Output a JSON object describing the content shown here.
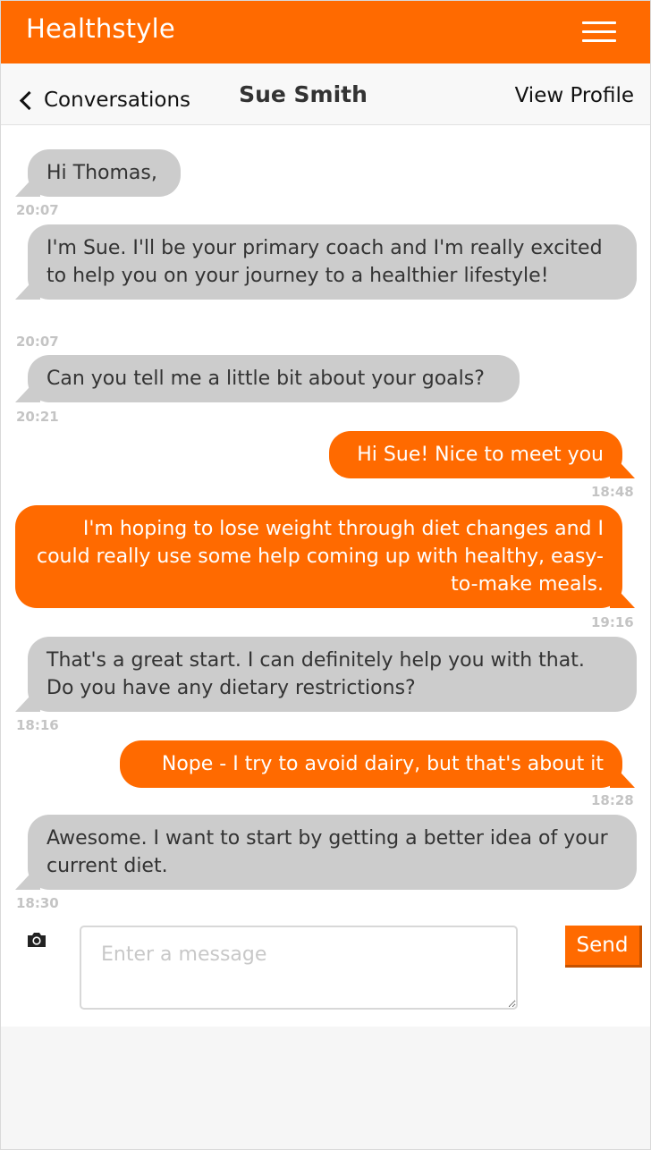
{
  "app": {
    "brand": "Healthstyle",
    "brand_color": "#ff6a00"
  },
  "header": {
    "back_label": "Conversations",
    "contact_name": "Sue Smith",
    "view_profile": "View Profile"
  },
  "messages": [
    {
      "from": "coach",
      "text": "Hi Thomas,",
      "time": "20:07"
    },
    {
      "from": "coach",
      "text": "I'm Sue. I'll be your primary coach and I'm really excited to help you on your journey to a healthier lifestyle!",
      "time": "20:07"
    },
    {
      "from": "coach",
      "text": "Can you tell me a little bit about your goals?",
      "time": "20:21"
    },
    {
      "from": "user",
      "text": "Hi Sue! Nice to meet you",
      "time": "18:48"
    },
    {
      "from": "user",
      "text": "I'm hoping to lose weight through diet changes and I could really use some help coming up with healthy, easy-to-make meals.",
      "time": "19:16"
    },
    {
      "from": "coach",
      "text": "That's a great start. I can definitely help you with that. Do you have any dietary restrictions?",
      "time": "18:16"
    },
    {
      "from": "user",
      "text": "Nope - I try to avoid dairy, but that's about it",
      "time": "18:28"
    },
    {
      "from": "coach",
      "text": "Awesome. I want to start by getting a better idea of your current diet.",
      "time": "18:30"
    }
  ],
  "composer": {
    "placeholder": "Enter a message",
    "send_label": "Send",
    "camera_icon": "camera-icon"
  }
}
